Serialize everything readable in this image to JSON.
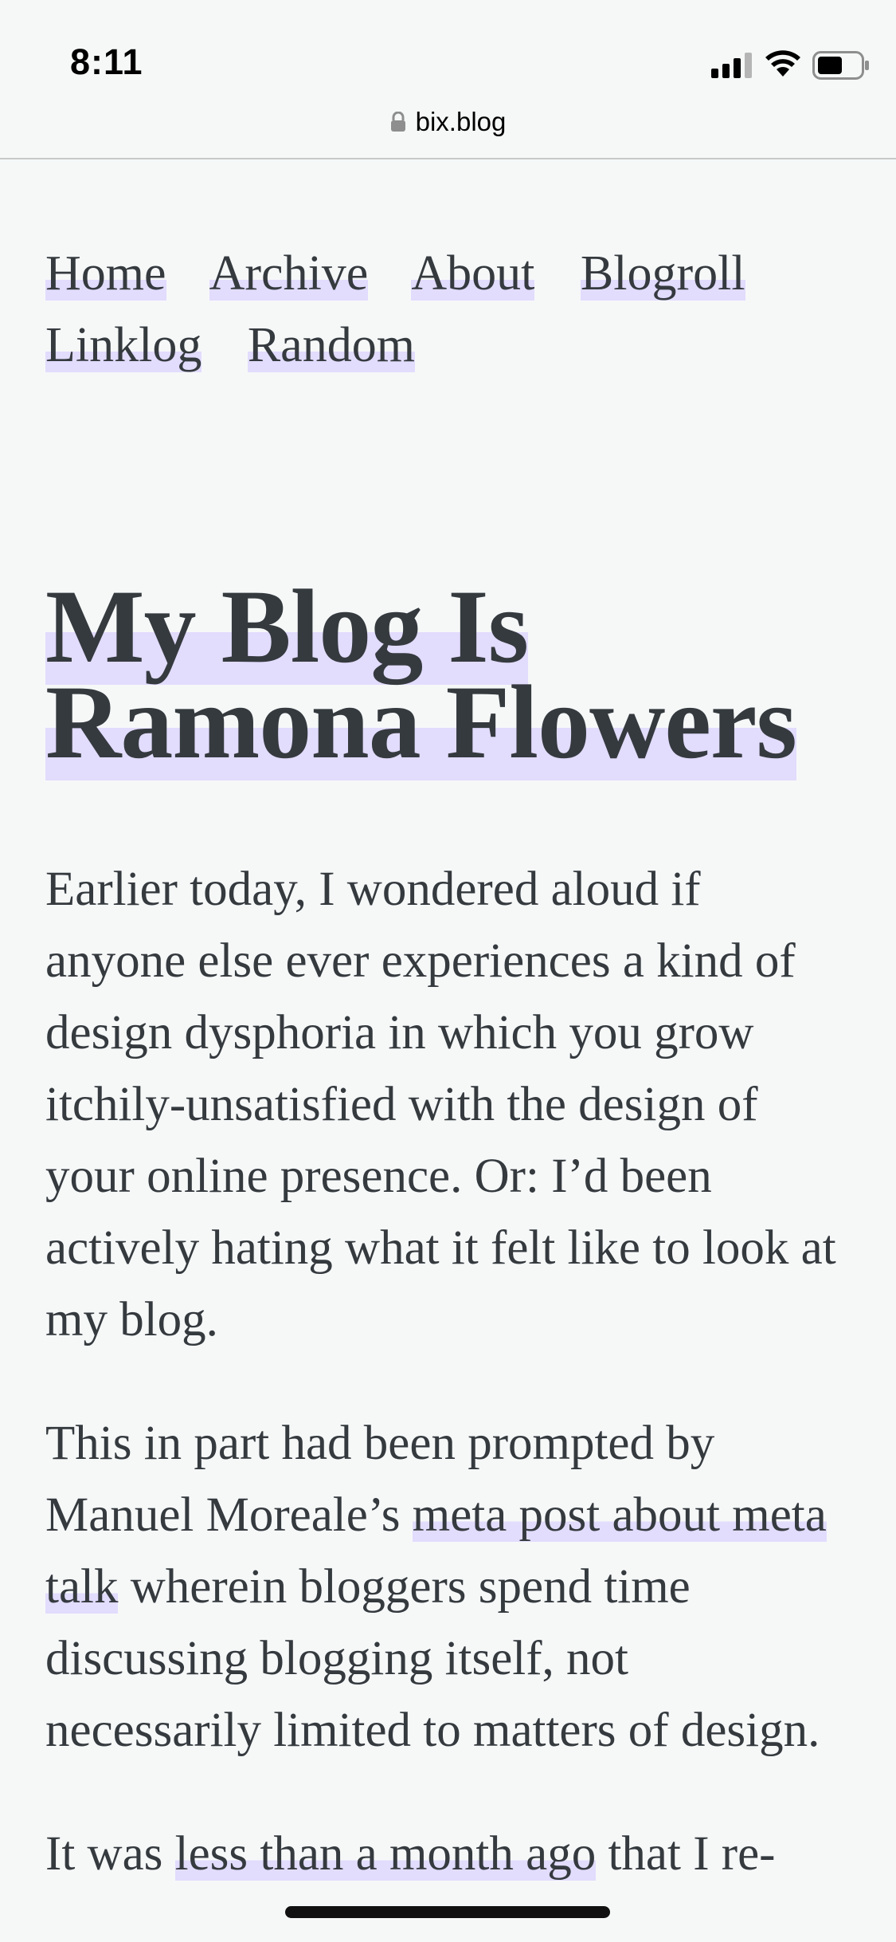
{
  "status_bar": {
    "time": "8:11",
    "signal_icon": "cellular-signal-icon",
    "wifi_icon": "wifi-icon",
    "battery_icon": "battery-icon"
  },
  "url_bar": {
    "lock_icon": "lock-icon",
    "domain": "bix.blog"
  },
  "nav": {
    "items": [
      {
        "label": "Home"
      },
      {
        "label": "Archive"
      },
      {
        "label": "About"
      },
      {
        "label": "Blogroll"
      },
      {
        "label": "Linklog"
      },
      {
        "label": "Random"
      }
    ]
  },
  "post": {
    "title": "My Blog Is Ramona Flowers",
    "p1": "Earlier today, I wondered aloud if anyone else ever experiences a kind of design dysphoria in which you grow itchily-unsatisfied with the design of your online presence. Or: I’d been actively hating what it felt like to look at my blog.",
    "p2_before": "This in part had been prompted by Manuel Moreale’s ",
    "p2_link": "meta post about meta talk",
    "p2_after": " wherein bloggers spend time discussing blogging itself, not necessarily limited to matters of design.",
    "p3_before": "It was ",
    "p3_link": "less than a month ago",
    "p3_after": " that I re-"
  },
  "colors": {
    "background": "#f6f8f8",
    "text": "#353a3f",
    "highlight": "#e2dcfd"
  }
}
